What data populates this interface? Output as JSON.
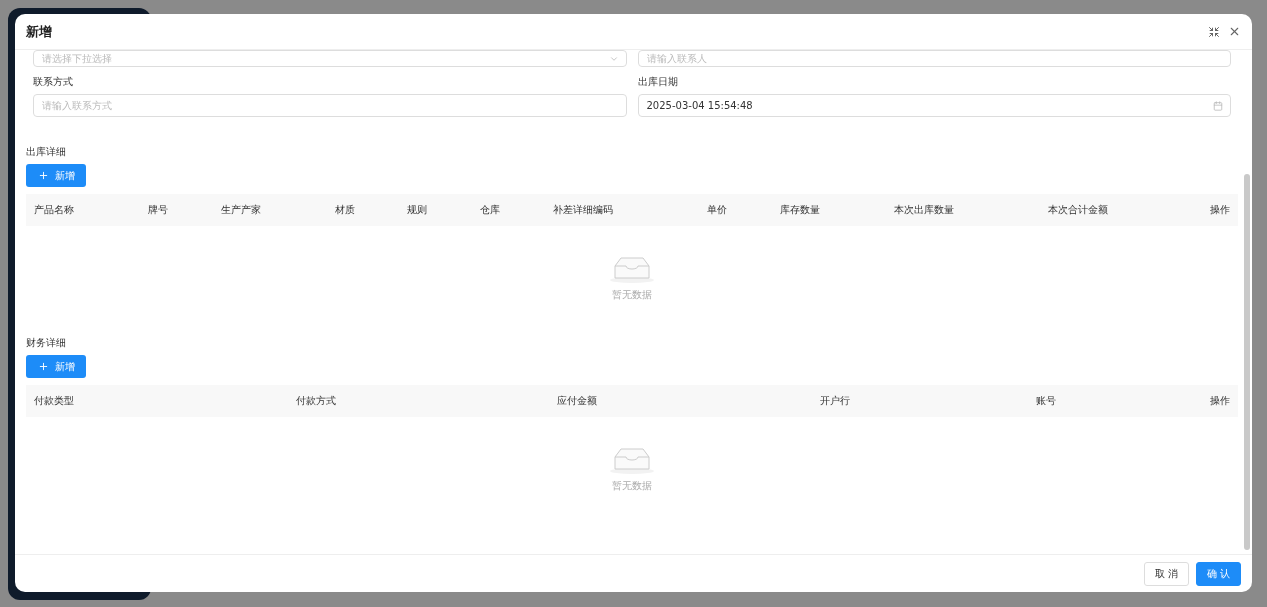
{
  "dialog": {
    "title": "新增"
  },
  "top_fields": [
    {
      "kind": "select",
      "placeholder": "请选择下拉选择"
    },
    {
      "kind": "input",
      "placeholder": "请输入联系人"
    }
  ],
  "fields": [
    {
      "kind": "input",
      "label": "联系方式",
      "placeholder": "请输入联系方式"
    },
    {
      "kind": "date",
      "label": "出库日期",
      "value": "2025-03-04 15:54:48"
    }
  ],
  "sections": [
    {
      "title": "出库详细",
      "add_button": "新增",
      "columns": [
        "产品名称",
        "牌号",
        "生产产家",
        "材质",
        "规则",
        "仓库",
        "补差详细编码",
        "单价",
        "库存数量",
        "本次出库数量",
        "本次合计金额",
        "操作"
      ],
      "empty_text": "暂无数据"
    },
    {
      "title": "财务详细",
      "add_button": "新增",
      "columns": [
        "付款类型",
        "付款方式",
        "应付金额",
        "开户行",
        "账号",
        "操作"
      ],
      "empty_text": "暂无数据"
    }
  ],
  "footer_buttons": [
    {
      "kind": "default",
      "label": "取 消"
    },
    {
      "kind": "primary",
      "label": "确 认"
    }
  ]
}
